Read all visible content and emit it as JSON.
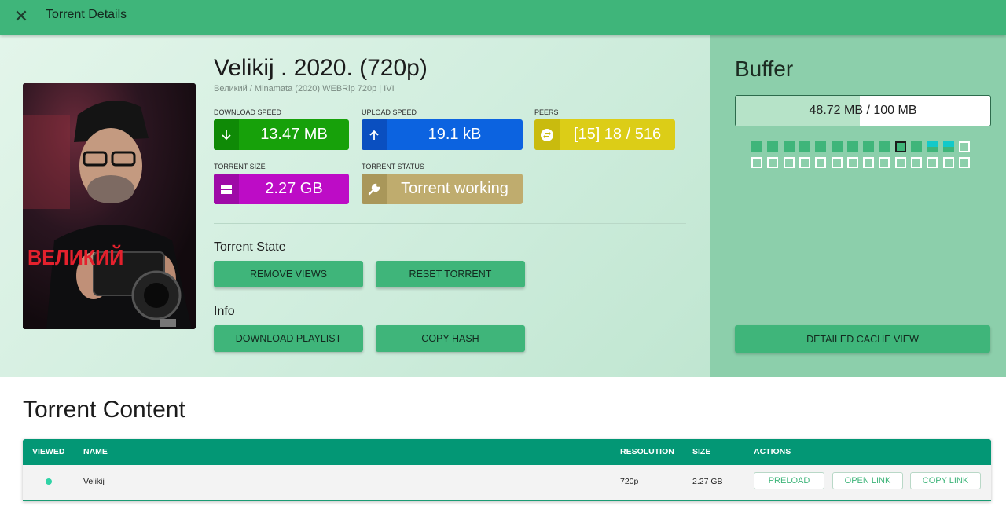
{
  "appbar": {
    "title": "Torrent Details",
    "close_icon": "close-icon"
  },
  "torrent": {
    "title": "Velikij . 2020. (720p)",
    "subtitle": "Великий / Minamata (2020) WEBRip 720p | IVI",
    "poster_text": "ВЕЛИКИЙ"
  },
  "stats": {
    "download": {
      "label": "DOWNLOAD SPEED",
      "value": "13.47 MB",
      "icon": "arrow-down-icon",
      "color": "#17a10a",
      "icon_bg": "#0f8a06"
    },
    "upload": {
      "label": "UPLOAD SPEED",
      "value": "19.1 kB",
      "icon": "arrow-up-icon",
      "color": "#0c63e0",
      "icon_bg": "#0a4fc0"
    },
    "peers": {
      "label": "PEERS",
      "value": "[15] 18 / 516",
      "icon": "peers-icon",
      "color": "#dccd17",
      "icon_bg": "#c9bb0e"
    },
    "size": {
      "label": "TORRENT SIZE",
      "value": "2.27 GB",
      "icon": "storage-icon",
      "color": "#bd0cc6",
      "icon_bg": "#9e0aa7"
    },
    "status": {
      "label": "TORRENT STATUS",
      "value": "Torrent working",
      "icon": "wrench-icon",
      "color": "#bfac6e",
      "icon_bg": "#a9975a"
    }
  },
  "state": {
    "heading": "Torrent State",
    "remove_views": "REMOVE VIEWS",
    "reset_torrent": "RESET TORRENT"
  },
  "info": {
    "heading": "Info",
    "download_playlist": "DOWNLOAD PLAYLIST",
    "copy_hash": "COPY HASH"
  },
  "buffer": {
    "title": "Buffer",
    "filled_mb": "48.72 MB",
    "total_mb": "100 MB",
    "separator": " / ",
    "fill_fraction": 0.487,
    "pieces": [
      "done",
      "done",
      "done",
      "done",
      "done",
      "done",
      "done",
      "done",
      "done",
      "current",
      "done",
      "partial",
      "partial",
      "empty",
      "empty",
      "empty",
      "empty",
      "empty",
      "empty",
      "empty",
      "empty",
      "empty",
      "empty",
      "empty",
      "empty",
      "empty",
      "empty",
      "empty"
    ],
    "detailed_cache_button": "DETAILED CACHE VIEW"
  },
  "content": {
    "title": "Torrent Content",
    "columns": {
      "viewed": "VIEWED",
      "name": "NAME",
      "resolution": "RESOLUTION",
      "size": "SIZE",
      "actions": "ACTIONS"
    },
    "rows": [
      {
        "viewed": true,
        "name": "Velikij",
        "resolution": "720p",
        "size": "2.27 GB",
        "preload": "PRELOAD",
        "open_link": "OPEN LINK",
        "copy_link": "COPY LINK"
      }
    ]
  },
  "colors": {
    "primary": "#3fb57a",
    "table_header": "#039775",
    "viewed_dot": "#2fd3a6"
  }
}
